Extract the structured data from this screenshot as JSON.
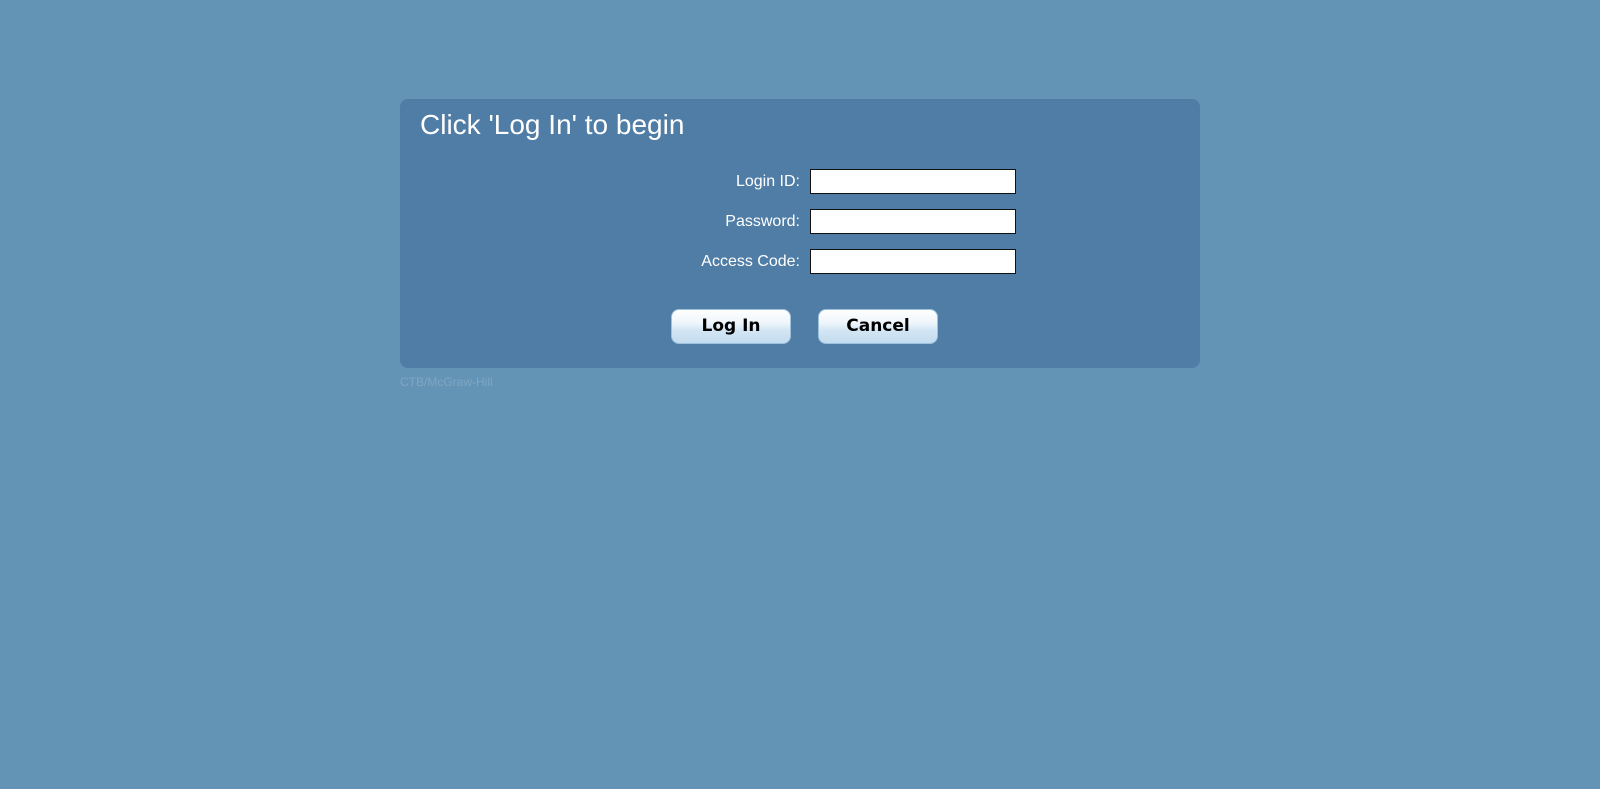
{
  "login_panel": {
    "title": "Click 'Log In' to begin",
    "fields": [
      {
        "label": "Login ID:",
        "value": ""
      },
      {
        "label": "Password:",
        "value": ""
      },
      {
        "label": "Access Code:",
        "value": ""
      }
    ],
    "login_button_label": "Log In",
    "cancel_button_label": "Cancel"
  },
  "footer": {
    "credit": "CTB/McGraw-Hill"
  },
  "colors": {
    "page_background": "#6394b6",
    "panel_background": "#4f7da5",
    "text": "#ffffff",
    "footer_text": "#7fa6c2"
  }
}
